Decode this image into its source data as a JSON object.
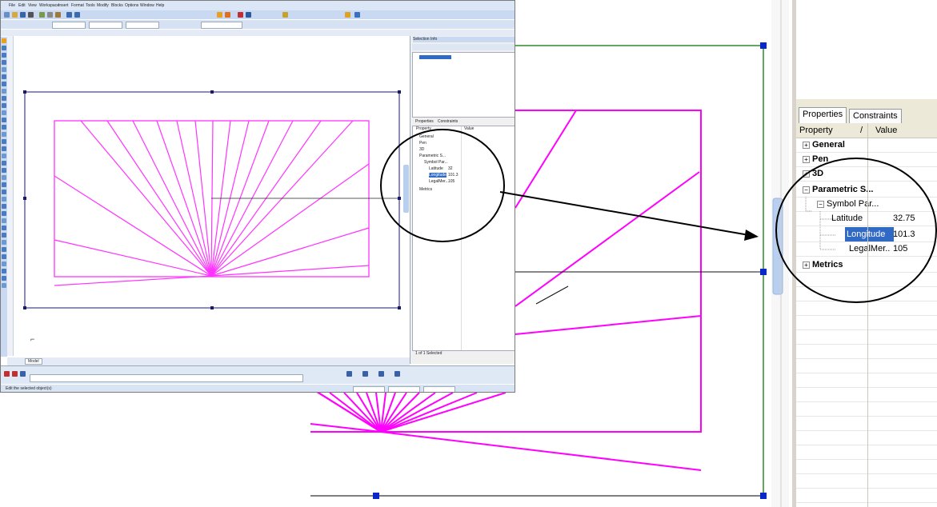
{
  "properties_panel": {
    "tabs": [
      {
        "label": "Properties",
        "active": true
      },
      {
        "label": "Constraints",
        "active": false
      }
    ],
    "columns": {
      "property": "Property",
      "sort_mark": "/",
      "value": "Value"
    },
    "rows": {
      "general": {
        "label": "General",
        "expander": "+"
      },
      "pen": {
        "label": "Pen",
        "expander": "+"
      },
      "threed": {
        "label": "3D",
        "expander": "+"
      },
      "parametric": {
        "label": "Parametric S...",
        "expander": "−"
      },
      "symbol_params": {
        "label": "Symbol Par...",
        "expander": "−"
      },
      "latitude": {
        "label": "Latitude",
        "value": "32.75"
      },
      "longitude": {
        "label": "Longitude",
        "value": "101.3"
      },
      "legal_meridian": {
        "label": "LegalMer..",
        "value": "105"
      },
      "metrics": {
        "label": "Metrics",
        "expander": "+"
      }
    }
  },
  "inset": {
    "menu": [
      "File",
      "Edit",
      "View",
      "Workspace",
      "Insert",
      "Format",
      "Tools",
      "Modify",
      "Blocks",
      "Options",
      "Window",
      "Help"
    ],
    "dock_title": "Selection Info",
    "dock_tabs": [
      "Properties",
      "Constraints"
    ],
    "dock_columns": [
      "Property",
      "Value"
    ],
    "dock_rows": [
      "General",
      "Pen",
      "3D",
      "Parametric S...",
      "Symbol Par...",
      "Latitude",
      "Longitude",
      "LegalMer...",
      "Metrics"
    ],
    "dock_values": [
      "32",
      "101.3",
      "105"
    ],
    "footer_label": "1 of 1 Selected",
    "model_tab": "Model",
    "status_text": "Edit the selected object(s)"
  },
  "colors": {
    "magenta": "#ff00ff",
    "selection_blue": "#0000ff",
    "handle_blue": "#0a28c8",
    "frame_green": "#2e8b2e",
    "highlight": "#316ac5"
  }
}
